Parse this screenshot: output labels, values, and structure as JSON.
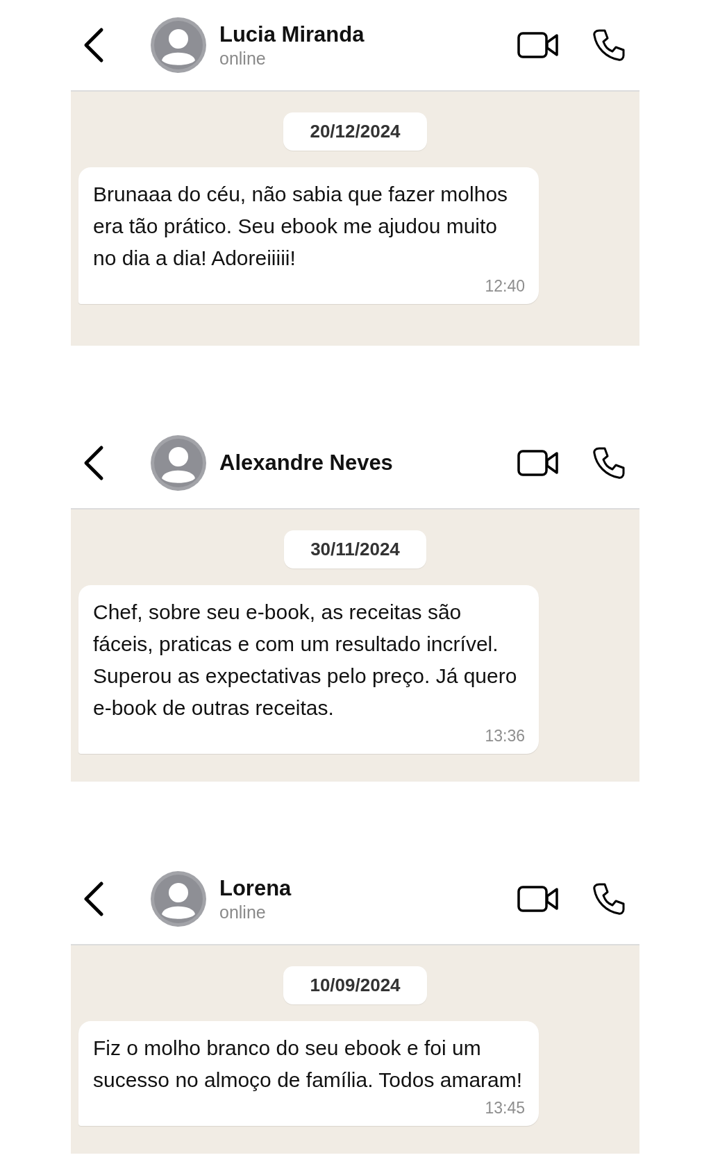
{
  "chats": [
    {
      "contact": {
        "name": "Lucia Miranda",
        "status": "online"
      },
      "date": "20/12/2024",
      "message": {
        "text": "Brunaaa do céu, não sabia que fazer molhos era tão prático. Seu ebook me ajudou muito no dia a dia! Adoreiiiii!",
        "time": "12:40"
      }
    },
    {
      "contact": {
        "name": "Alexandre Neves"
      },
      "date": "30/11/2024",
      "message": {
        "text": "Chef, sobre seu e-book, as receitas são fáceis, praticas e com um resultado incrível. Superou as expectativas pelo preço. Já quero e-book de outras receitas.",
        "time": "13:36"
      }
    },
    {
      "contact": {
        "name": "Lorena",
        "status": "online"
      },
      "date": "10/09/2024",
      "message": {
        "text": "Fiz o molho branco do seu ebook e foi um sucesso no almoço de família. Todos amaram!",
        "time": "13:45"
      }
    }
  ]
}
